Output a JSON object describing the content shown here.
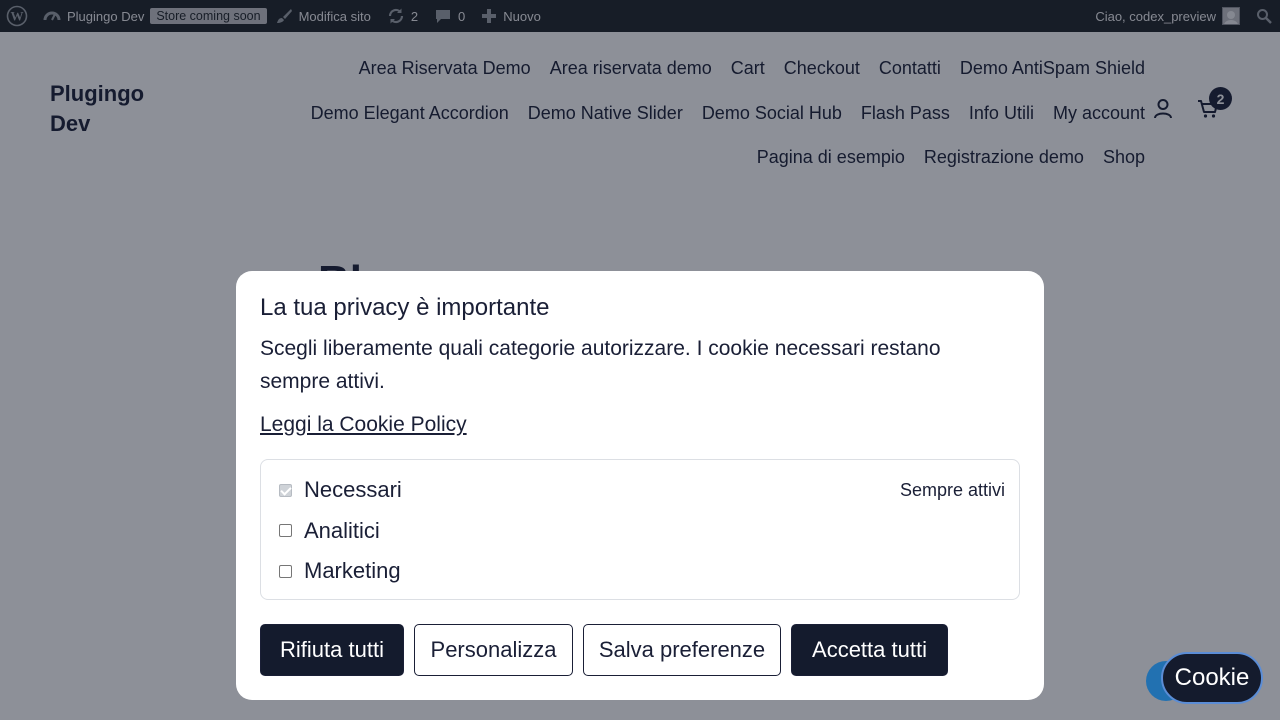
{
  "adminbar": {
    "site_name": "Plugingo Dev",
    "store_badge": "Store coming soon",
    "edit_site": "Modifica sito",
    "updates_count": "2",
    "comments_count": "0",
    "new_label": "Nuovo",
    "greeting": "Ciao, codex_preview"
  },
  "header": {
    "brand": "Plugingo Dev",
    "cart_count": "2",
    "nav": [
      "Area Riservata Demo",
      "Area riservata demo",
      "Cart",
      "Checkout",
      "Contatti",
      "Demo AntiSpam Shield",
      "Demo Elegant Accordion",
      "Demo Native Slider",
      "Demo Social Hub",
      "Flash Pass",
      "Info Utili",
      "My account",
      "Pagina di esempio",
      "Registrazione demo",
      "Shop"
    ]
  },
  "page": {
    "heading_partial": "Bl"
  },
  "cookie_modal": {
    "title": "La tua privacy è importante",
    "description": "Scegli liberamente quali categorie autorizzare. I cookie necessari restano sempre attivi.",
    "policy_link": "Leggi la Cookie Policy",
    "categories": [
      {
        "label": "Necessari",
        "checked": true,
        "disabled": true,
        "note": "Sempre attivi"
      },
      {
        "label": "Analitici",
        "checked": false,
        "disabled": false,
        "note": ""
      },
      {
        "label": "Marketing",
        "checked": false,
        "disabled": false,
        "note": ""
      }
    ],
    "buttons": {
      "reject_all": "Rifiuta tutti",
      "customize": "Personalizza",
      "save_preferences": "Salva preferenze",
      "accept_all": "Accetta tutti"
    }
  },
  "floating": {
    "cookie_label": "Cookie"
  },
  "icons": {
    "wp_logo": "wordpress-logo-icon",
    "site": "dashboard-icon",
    "edit": "paintbrush-icon",
    "updates": "refresh-icon",
    "comments": "comment-icon",
    "new": "plus-icon",
    "search": "search-icon",
    "account": "user-icon",
    "cart": "cart-icon"
  },
  "colors": {
    "adminbar_bg": "#1d2327",
    "primary_dark": "#141b2d",
    "text": "#1a1f36",
    "fab_blue": "#2271b1"
  }
}
